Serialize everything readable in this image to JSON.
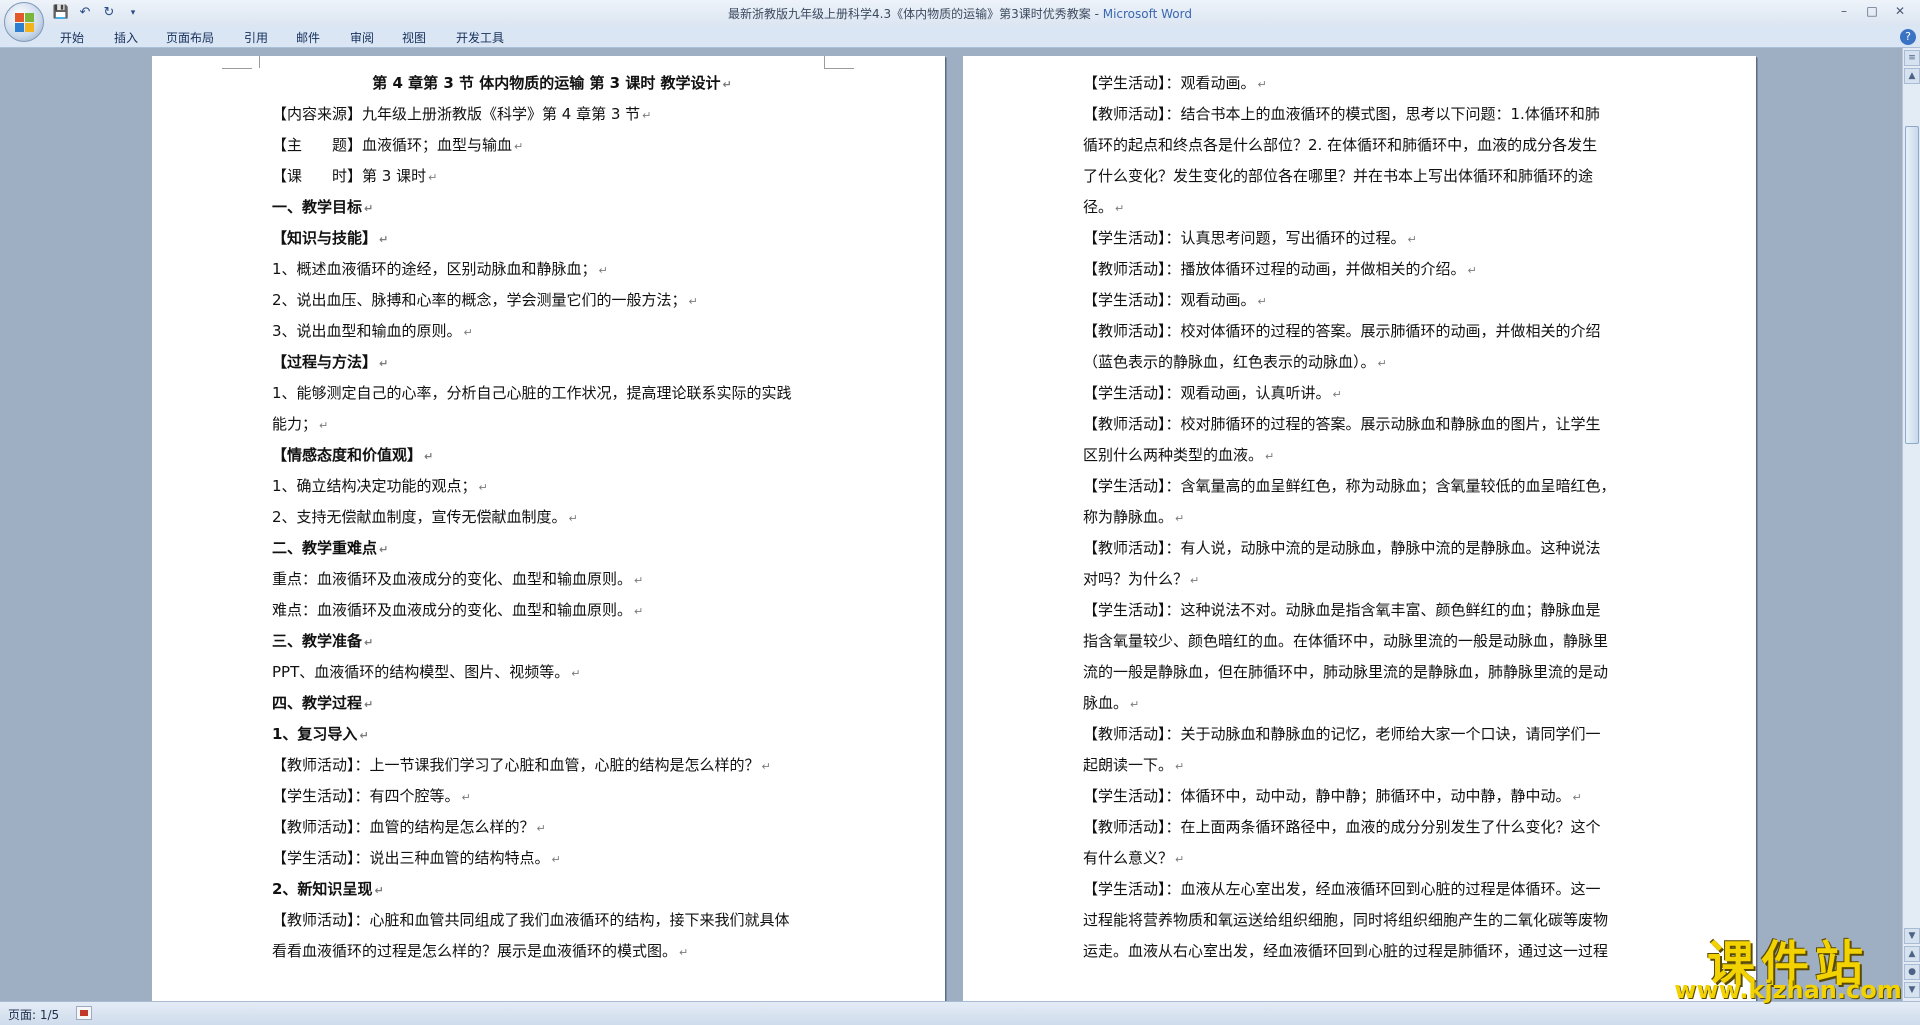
{
  "window": {
    "title": "最新浙教版九年级上册科学4.3《体内物质的运输》第3课时优秀教案",
    "app_name": "Microsoft Word",
    "minimize_icon": "minimize-icon",
    "maximize_icon": "maximize-icon",
    "close_icon": "close-icon"
  },
  "quick_access": {
    "save_icon": "save-icon",
    "undo_icon": "undo-icon",
    "redo_icon": "redo-icon",
    "customize_icon": "dropdown-icon"
  },
  "ribbon": {
    "tabs": [
      "开始",
      "插入",
      "页面布局",
      "引用",
      "邮件",
      "审阅",
      "视图",
      "开发工具"
    ]
  },
  "page1": {
    "title": "第 4 章第 3 节 体内物质的运输 第 3 课时 教学设计",
    "lines": [
      "【内容来源】九年级上册浙教版《科学》第 4 章第 3 节",
      "【主　　题】血液循环；血型与输血",
      "【课　　时】第 3 课时",
      "一、教学目标",
      "【知识与技能】",
      "1、概述血液循环的途经，区别动脉血和静脉血；",
      "2、说出血压、脉搏和心率的概念，学会测量它们的一般方法；",
      "3、说出血型和输血的原则。",
      "【过程与方法】",
      "1、能够测定自己的心率，分析自己心脏的工作状况，提高理论联系实际的实践",
      "能力；",
      "【情感态度和价值观】",
      "1、确立结构决定功能的观点；",
      "2、支持无偿献血制度，宣传无偿献血制度。",
      "二、教学重难点",
      "重点：血液循环及血液成分的变化、血型和输血原则。",
      "难点：血液循环及血液成分的变化、血型和输血原则。",
      "三、教学准备",
      "PPT、血液循环的结构模型、图片、视频等。",
      "四、教学过程",
      "1、复习导入",
      "【教师活动】：上一节课我们学习了心脏和血管，心脏的结构是怎么样的？",
      "【学生活动】：有四个腔等。",
      "【教师活动】：血管的结构是怎么样的？",
      "【学生活动】：说出三种血管的结构特点。",
      "2、新知识呈现",
      "【教师活动】：心脏和血管共同组成了我们血液循环的结构，接下来我们就具体",
      "看看血液循环的过程是怎么样的？展示是血液循环的模式图。"
    ]
  },
  "page2": {
    "lines": [
      "【学生活动】：观看动画。",
      "【教师活动】：结合书本上的血液循环的模式图，思考以下问题：1.体循环和肺",
      "循环的起点和终点各是什么部位？2. 在体循环和肺循环中，血液的成分各发生",
      "了什么变化？发生变化的部位各在哪里？并在书本上写出体循环和肺循环的途",
      "径。",
      "【学生活动】：认真思考问题，写出循环的过程。",
      "【教师活动】：播放体循环过程的动画，并做相关的介绍。",
      "【学生活动】：观看动画。",
      "【教师活动】：校对体循环的过程的答案。展示肺循环的动画，并做相关的介绍",
      "（蓝色表示的静脉血，红色表示的动脉血）。",
      "【学生活动】：观看动画，认真听讲。",
      "【教师活动】：校对肺循环的过程的答案。展示动脉血和静脉血的图片，让学生",
      "区别什么两种类型的血液。",
      "【学生活动】：含氧量高的血呈鲜红色，称为动脉血；含氧量较低的血呈暗红色，",
      "称为静脉血。",
      "【教师活动】：有人说，动脉中流的是动脉血，静脉中流的是静脉血。这种说法",
      "对吗？为什么？",
      "【学生活动】：这种说法不对。动脉血是指含氧丰富、颜色鲜红的血；静脉血是",
      "指含氧量较少、颜色暗红的血。在体循环中，动脉里流的一般是动脉血，静脉里",
      "流的一般是静脉血，但在肺循环中，肺动脉里流的是静脉血，肺静脉里流的是动",
      "脉血。",
      "【教师活动】：关于动脉血和静脉血的记忆，老师给大家一个口诀，请同学们一",
      "起朗读一下。",
      "【学生活动】：体循环中，动中动，静中静；肺循环中，动中静，静中动。",
      "【教师活动】：在上面两条循环路径中，血液的成分分别发生了什么变化？这个",
      "有什么意义？",
      "【学生活动】：血液从左心室出发，经血液循环回到心脏的过程是体循环。这一",
      "过程能将营养物质和氧运送给组织细胞，同时将组织细胞产生的二氧化碳等废物",
      "运走。血液从右心室出发，经血液循环回到心脏的过程是肺循环，通过这一过程"
    ]
  },
  "statusbar": {
    "page_info": "页面: 1/5"
  },
  "watermark": {
    "title": "课件站",
    "url": "www.kjzhan.com"
  }
}
